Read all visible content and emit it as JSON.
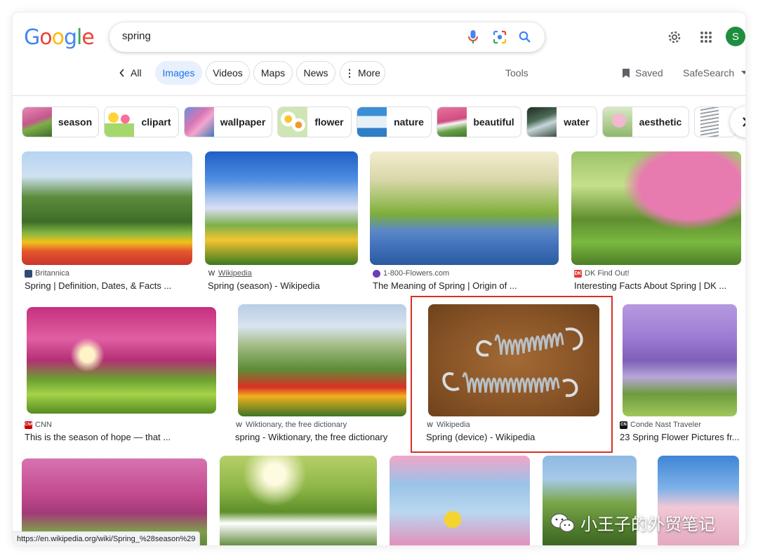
{
  "logo": {
    "letters": [
      "G",
      "o",
      "o",
      "g",
      "l",
      "e"
    ],
    "colors": [
      "#4285f4",
      "#ea4335",
      "#fbbc05",
      "#4285f4",
      "#34a853",
      "#ea4335"
    ]
  },
  "search": {
    "query": "spring"
  },
  "header": {
    "avatar_letter": "S"
  },
  "tabs": {
    "all": "All",
    "images": "Images",
    "videos": "Videos",
    "maps": "Maps",
    "news": "News",
    "more": "More",
    "tools": "Tools",
    "saved": "Saved",
    "safesearch": "SafeSearch"
  },
  "chips": [
    "season",
    "clipart",
    "wallpaper",
    "flower",
    "nature",
    "beautiful",
    "water",
    "aesthetic"
  ],
  "results": [
    {
      "source": "Britannica",
      "title": "Spring | Definition, Dates, & Facts ..."
    },
    {
      "source": "Wikipedia",
      "title": "Spring (season) - Wikipedia"
    },
    {
      "source": "1-800-Flowers.com",
      "title": "The Meaning of Spring | Origin of ..."
    },
    {
      "source": "DK Find Out!",
      "title": "Interesting Facts About Spring | DK ..."
    },
    {
      "source": "CNN",
      "title": "This is the season of hope — that ..."
    },
    {
      "source": "Wiktionary, the free dictionary",
      "title": "spring - Wiktionary, the free dictionary"
    },
    {
      "source": "Wikipedia",
      "title": "Spring (device) - Wikipedia"
    },
    {
      "source": "Conde Nast Traveler",
      "title": "23 Spring Flower Pictures fr..."
    }
  ],
  "status_url": "https://en.wikipedia.org/wiki/Spring_%28season%29",
  "watermark": "小王子的外贸笔记",
  "colors": {
    "accent": "#1a73e8",
    "highlight": "#d93025"
  }
}
